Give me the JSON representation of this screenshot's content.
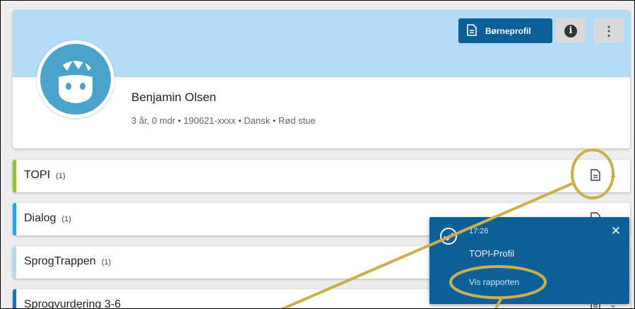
{
  "header": {
    "profile_button": "Børneprofil",
    "info_icon": "info-icon",
    "more_icon": "kebab-icon"
  },
  "child": {
    "name": "Benjamin Olsen",
    "meta": "3 år, 0 mdr • 190621-xxxx • Dansk • Rød stue"
  },
  "sections": [
    {
      "title": "TOPI",
      "count": "(1)",
      "accent": "#8cc63f"
    },
    {
      "title": "Dialog",
      "count": "(1)",
      "accent": "#29a8e0"
    },
    {
      "title": "SprogTrappen",
      "count": "(1)",
      "accent": "#b3dcf9"
    },
    {
      "title": "Sprogvurdering 3-6",
      "count": "",
      "accent": "#1f6fb4"
    }
  ],
  "toast": {
    "time": "17:26",
    "message": "TOPI-Profil",
    "link": "Vis rapporten"
  },
  "colors": {
    "primary": "#0d5f98",
    "banner": "#b3dcf9",
    "annotation": "#c9b04d"
  }
}
